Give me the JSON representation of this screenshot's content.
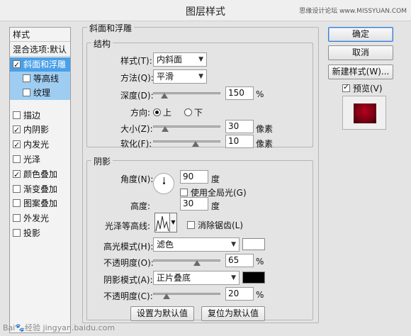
{
  "window": {
    "title": "图层样式",
    "watermark": "思缘设计论坛 www.MISSYUAN.COM"
  },
  "sidebar": {
    "header": "样式",
    "blend_label": "混合选项:默认",
    "items": [
      {
        "label": "斜面和浮雕",
        "checked": true,
        "selected": true
      },
      {
        "label": "等高线",
        "checked": false,
        "sub": true
      },
      {
        "label": "纹理",
        "checked": false,
        "sub": true
      },
      {
        "label": "描边",
        "checked": false
      },
      {
        "label": "内阴影",
        "checked": true
      },
      {
        "label": "内发光",
        "checked": true
      },
      {
        "label": "光泽",
        "checked": false
      },
      {
        "label": "颜色叠加",
        "checked": true
      },
      {
        "label": "渐变叠加",
        "checked": false
      },
      {
        "label": "图案叠加",
        "checked": false
      },
      {
        "label": "外发光",
        "checked": false
      },
      {
        "label": "投影",
        "checked": false
      }
    ]
  },
  "bevel": {
    "group_title": "斜面和浮雕",
    "structure": {
      "title": "结构",
      "style_label": "样式(T):",
      "style_value": "内斜面",
      "method_label": "方法(Q):",
      "method_value": "平滑",
      "depth_label": "深度(D):",
      "depth_value": "150",
      "depth_unit": "%",
      "direction_label": "方向:",
      "dir_up": "上",
      "dir_down": "下",
      "size_label": "大小(Z):",
      "size_value": "30",
      "size_unit": "像素",
      "soften_label": "软化(F):",
      "soften_value": "10",
      "soften_unit": "像素"
    },
    "shading": {
      "title": "阴影",
      "angle_label": "角度(N):",
      "angle_value": "90",
      "angle_unit": "度",
      "global_light_label": "使用全局光(G)",
      "altitude_label": "高度:",
      "altitude_value": "30",
      "altitude_unit": "度",
      "gloss_label": "光泽等高线:",
      "antialias_label": "消除锯齿(L)",
      "highlight_mode_label": "高光模式(H):",
      "highlight_mode_value": "滤色",
      "highlight_color": "#ffffff",
      "highlight_opacity_label": "不透明度(O):",
      "highlight_opacity_value": "65",
      "highlight_opacity_unit": "%",
      "shadow_mode_label": "阴影模式(A):",
      "shadow_mode_value": "正片叠底",
      "shadow_color": "#000000",
      "shadow_opacity_label": "不透明度(C):",
      "shadow_opacity_value": "20",
      "shadow_opacity_unit": "%"
    },
    "set_default_label": "设置为默认值",
    "reset_default_label": "复位为默认值"
  },
  "right": {
    "ok_label": "确定",
    "cancel_label": "取消",
    "new_style_label": "新建样式(W)...",
    "preview_label": "预览(V)",
    "preview_checked": true
  },
  "footer_watermark": "Bai🐾经验 jingyan.baidu.com"
}
